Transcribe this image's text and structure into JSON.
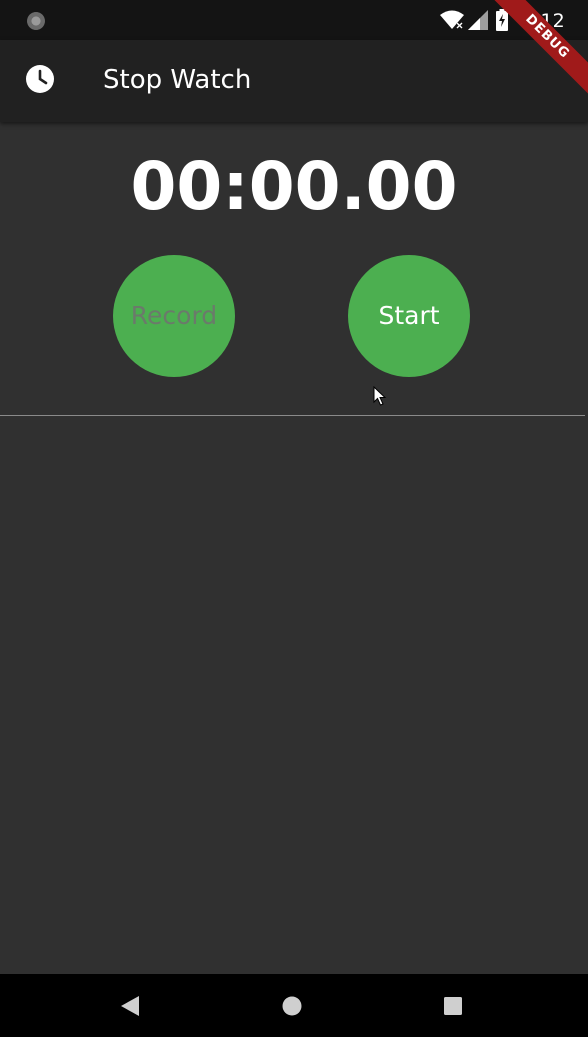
{
  "status_bar": {
    "time": "4:12",
    "icons": [
      "notification-dot-icon",
      "wifi-icon",
      "signal-icon",
      "battery-charging-icon"
    ]
  },
  "app_bar": {
    "icon": "clock-icon",
    "title": "Stop Watch"
  },
  "debug_banner": {
    "label": "DEBUG",
    "color": "#a01a1a"
  },
  "timer": {
    "display": "00:00.00"
  },
  "buttons": {
    "record_label": "Record",
    "start_label": "Start",
    "color": "#4caf50"
  },
  "records": [],
  "nav_bar": {
    "icons": [
      "back-icon",
      "home-icon",
      "recents-icon"
    ]
  }
}
